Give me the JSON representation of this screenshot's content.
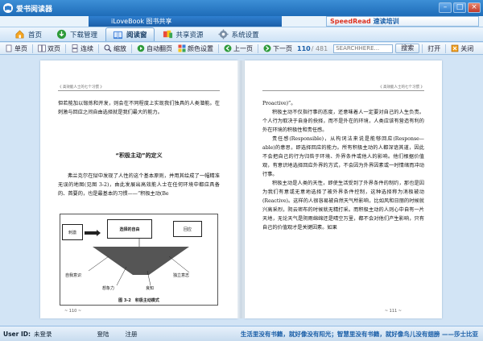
{
  "window": {
    "title": "爱书阅读器"
  },
  "banner": {
    "left_text": "iLoveBook 图书共享",
    "right_text_brand": "SpeedRead",
    "right_text_rest": " 速读培训"
  },
  "nav": {
    "tabs": [
      {
        "label": "首页",
        "icon": "home-icon"
      },
      {
        "label": "下载管理",
        "icon": "download-icon"
      },
      {
        "label": "阅读窗",
        "icon": "book-icon",
        "active": true
      },
      {
        "label": "共享资源",
        "icon": "share-icon"
      },
      {
        "label": "系统设置",
        "icon": "gear-icon"
      }
    ]
  },
  "toolbar": {
    "single": "单页",
    "double": "双页",
    "continuous": "连续",
    "zoom": "缩放",
    "auto_flip": "自动翻页",
    "color": "颜色设置",
    "prev": "上一页",
    "next": "下一页",
    "current_page": "110",
    "total_pages": "/ 481",
    "search_placeholder": "SEARCHHERE...",
    "search_btn": "搜索",
    "open": "打开",
    "close": "关闭"
  },
  "book": {
    "left": {
      "running_head": "《 高效能人士的七个习惯 》",
      "para1": "但若能加以锻炼和开发，则会在不同程度上实现我们独具的人类潜能。在刺激与回应之间自由选择就是我们最大的能力。",
      "heading": "“积极主动”的定义",
      "para2": "弗兰克尔在狱中发现了人性的这个基本原则，并用其绘成了一幅精准无误的地图(见图 3-2)，由此发展出高效能人士在任何环境中都应具备的、首要的，也是最基本的习惯——“积极主动(Be",
      "figure": {
        "box_stimulus": "刺激",
        "box_choice": "选择的自由",
        "box_response": "回应",
        "label_self_awareness": "自我意识",
        "label_imagination": "想象力",
        "label_conscience": "良知",
        "label_independent_will": "独立意志",
        "caption": "图 3-2　积极主动模式"
      },
      "footer": "~ 110 ~"
    },
    "right": {
      "running_head": "《 高效能人士的七个习惯 》",
      "para1": "Proactive)”。",
      "para2": "积极主动不仅指行事的态度，还意味着人一定要对自己的人生负责。个人行为取决于自身的抉择，而不是外在的环境，人类应该有营造有利的外在环境的积极性和责任感。",
      "para3": "责任感(Responsible)，从构词法来说是能够回应(Response—able)的意思，即选择回应的能力。所有积极主动的人都深谙其道，因此不会把自己的行为归咎于环境、外界条件或他人的影响。他们根据价值观，有意识地选择回应外界的方式，不会因为外界因素或一时情绪而冲动行事。",
      "para4": "积极主动是人类的天性，即使生活受到了外界条件的制约，那也是因为我们有意或无意地选择了被外界条件控制，这种选择称为消极被动(Reactive)。这样的人很容易被自然天气所影响，比如风和日丽的时候就兴高采烈，阴云密布的时候就无精打采。而积极主动的人则心中自有一片天地，无论天气是阴雨绵绵还是晴空万里，都不会对他们产生影响，只有自己的价值观才是关键因素。如果",
      "footer": "~ 111 ~"
    }
  },
  "status": {
    "user_id_label": "User ID:",
    "user_id_value": "未登录",
    "login": "登陆",
    "register": "注册",
    "marquee": "生活里没有书籍，就好像没有阳光；智慧里没有书籍，就好像鸟儿没有翅膀  ——莎士比亚"
  }
}
